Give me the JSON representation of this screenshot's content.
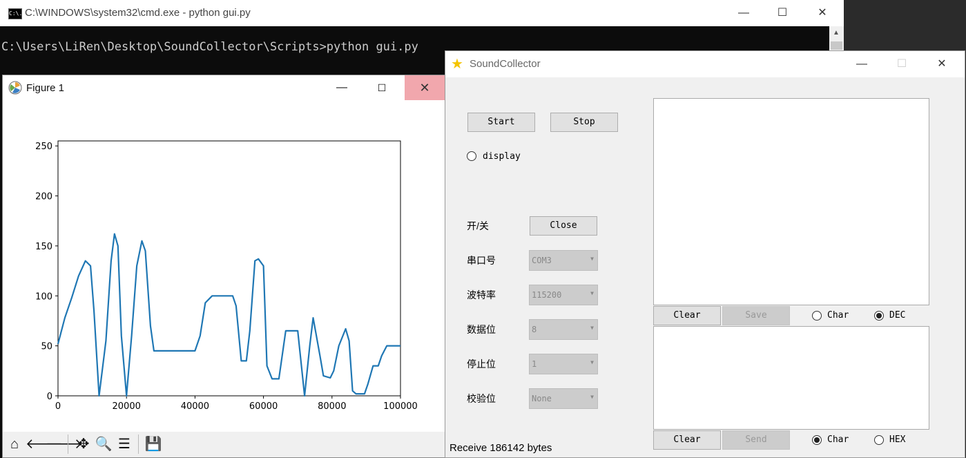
{
  "cmd": {
    "title": "C:\\WINDOWS\\system32\\cmd.exe - python  gui.py",
    "icon_text": "C:\\.",
    "line": "C:\\Users\\LiRen\\Desktop\\SoundCollector\\Scripts>python gui.py",
    "min": "—",
    "max": "☐",
    "close": "✕"
  },
  "figure": {
    "title": "Figure 1",
    "min": "—",
    "max": "☐",
    "close": "✕",
    "toolbar": [
      "home-icon",
      "back-icon",
      "forward-icon",
      "pan-icon",
      "zoom-icon",
      "configure-icon",
      "save-icon"
    ]
  },
  "chart_data": {
    "type": "line",
    "xlim": [
      0,
      100000
    ],
    "ylim": [
      0,
      255
    ],
    "xticks": [
      "0",
      "20000",
      "40000",
      "60000",
      "80000",
      "100000"
    ],
    "yticks": [
      "0",
      "50",
      "100",
      "150",
      "200",
      "250"
    ],
    "line_color": "#1f77b4",
    "series": [
      {
        "x": [
          0,
          2000,
          4000,
          6000,
          8000,
          9500,
          10500,
          12000,
          14000,
          15500,
          16500,
          17500,
          18500,
          20000,
          21500,
          23000,
          24500,
          25500,
          27000,
          28000,
          30000,
          35000,
          40000,
          41500,
          43000,
          45000,
          48000,
          51000,
          52000,
          53500,
          55000,
          56000,
          57500,
          58500,
          60000,
          61000,
          62500,
          64500,
          66500,
          67500,
          70000,
          72000,
          73500,
          74500,
          76500,
          77500,
          79500,
          80500,
          82000,
          84000,
          85000,
          86000,
          87000,
          88000,
          89500,
          90500,
          92000,
          93500,
          94500,
          96000,
          98000,
          100000
        ],
        "y": [
          52,
          78,
          98,
          120,
          135,
          130,
          85,
          0,
          55,
          135,
          162,
          150,
          60,
          0,
          60,
          130,
          155,
          145,
          70,
          45,
          45,
          45,
          45,
          60,
          93,
          100,
          100,
          100,
          90,
          35,
          35,
          65,
          135,
          137,
          130,
          30,
          17,
          17,
          65,
          65,
          65,
          0,
          50,
          78,
          40,
          20,
          18,
          25,
          50,
          67,
          55,
          5,
          2,
          2,
          2,
          12,
          30,
          30,
          40,
          50,
          50,
          50
        ]
      }
    ]
  },
  "app": {
    "title": "SoundCollector",
    "min": "—",
    "max": "☐",
    "close": "✕",
    "start": "Start",
    "stop": "Stop",
    "display": "display",
    "labels": [
      "开/关",
      "串口号",
      "波特率",
      "数据位",
      "停止位",
      "校验位"
    ],
    "close_port": "Close",
    "port": "COM3",
    "baud": "115200",
    "databits": "8",
    "stopbits": "1",
    "parity": "None",
    "recv": {
      "clear": "Clear",
      "save": "Save",
      "char": "Char",
      "dec": "DEC",
      "selected": "DEC"
    },
    "send": {
      "clear": "Clear",
      "send": "Send",
      "char": "Char",
      "hex": "HEX",
      "selected": "Char"
    },
    "status": "Receive 186142 bytes"
  }
}
